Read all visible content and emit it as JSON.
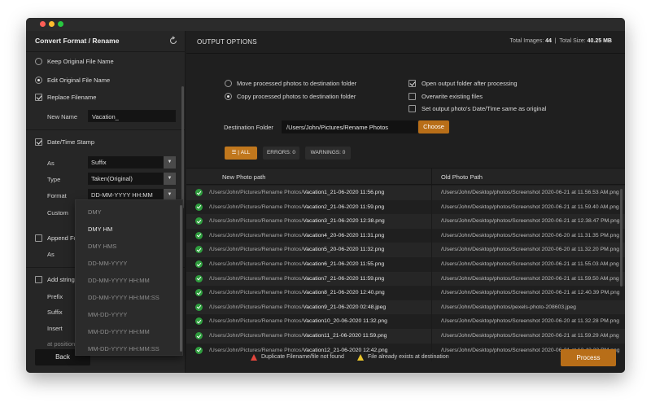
{
  "sidebar": {
    "title": "Convert Format / Rename",
    "keep_original": "Keep Original File Name",
    "edit_original": "Edit Original File Name",
    "replace_filename": "Replace Filename",
    "new_name_label": "New Name",
    "new_name_value": "Vacation_",
    "datetime_stamp": "Date/Time Stamp",
    "as_label": "As",
    "as_value": "Suffix",
    "type_label": "Type",
    "type_value": "Taken(Original)",
    "format_label": "Format",
    "format_value": "DD-MM-YYYY HH:MM",
    "custom_label": "Custom",
    "append_label": "Append Fo",
    "as2_label": "As",
    "add_string_label": "Add string",
    "prefix_label": "Prefix",
    "suffix_label": "Suffix",
    "insert_label": "Insert",
    "at_position_label": "at position",
    "back_label": "Back"
  },
  "format_dropdown": {
    "options": [
      "DMY",
      "DMY HM",
      "DMY HMS",
      "DD-MM-YYYY",
      "DD-MM-YYYY HH:MM",
      "DD-MM-YYYY HH:MM:SS",
      "MM-DD-YYYY",
      "MM-DD-YYYY HH:MM",
      "MM-DD-YYYY HH:MM:SS"
    ],
    "highlighted": "DMY HM"
  },
  "main": {
    "title": "OUTPUT OPTIONS",
    "total_images_label": "Total Images:",
    "total_images": "44",
    "total_size_label": "Total Size:",
    "total_size": "40.25 MB",
    "move_option": "Move processed photos to destination folder",
    "copy_option": "Copy processed photos to destination folder",
    "open_output": "Open output folder after processing",
    "overwrite": "Overwrite existing files",
    "set_datetime": "Set output photo's Date/Time same as original",
    "dest_label": "Destination Folder",
    "dest_value": "/Users/John/Pictures/Rename Photos",
    "choose_label": "Choose",
    "filter_all": "ALL",
    "filter_errors": "ERRORS: 0",
    "filter_warnings": "WARNINGS: 0",
    "col_new": "New Photo path",
    "col_old": "Old Photo Path",
    "legend_duplicate": "Duplicate Filename/file not found",
    "legend_exists": "File already exists at destination",
    "process_label": "Process"
  },
  "rows": [
    {
      "dir": "/Users/John/Pictures/Rename Photos/",
      "file": "Vacation1_21-06-2020 11:56.png",
      "old": "/Users/John/Desktop/photos/Screenshot 2020-06-21 at 11.56.53 AM.png"
    },
    {
      "dir": "/Users/John/Pictures/Rename Photos/",
      "file": "Vacation2_21-06-2020 11:59.png",
      "old": "/Users/John/Desktop/photos/Screenshot 2020-06-21 at 11.59.40 AM.png"
    },
    {
      "dir": "/Users/John/Pictures/Rename Photos/",
      "file": "Vacation3_21-06-2020 12:38.png",
      "old": "/Users/John/Desktop/photos/Screenshot 2020-06-21 at 12.38.47 PM.png"
    },
    {
      "dir": "/Users/John/Pictures/Rename Photos/",
      "file": "Vacation4_20-06-2020 11:31.png",
      "old": "/Users/John/Desktop/photos/Screenshot 2020-06-20 at 11.31.35 PM.png"
    },
    {
      "dir": "/Users/John/Pictures/Rename Photos/",
      "file": "Vacation5_20-06-2020 11:32.png",
      "old": "/Users/John/Desktop/photos/Screenshot 2020-06-20 at 11.32.20 PM.png"
    },
    {
      "dir": "/Users/John/Pictures/Rename Photos/",
      "file": "Vacation6_21-06-2020 11:55.png",
      "old": "/Users/John/Desktop/photos/Screenshot 2020-06-21 at 11.55.03 AM.png"
    },
    {
      "dir": "/Users/John/Pictures/Rename Photos/",
      "file": "Vacation7_21-06-2020 11:59.png",
      "old": "/Users/John/Desktop/photos/Screenshot 2020-06-21 at 11.59.50 AM.png"
    },
    {
      "dir": "/Users/John/Pictures/Rename Photos/",
      "file": "Vacation8_21-06-2020 12:40.png",
      "old": "/Users/John/Desktop/photos/Screenshot 2020-06-21 at 12.40.39 PM.png"
    },
    {
      "dir": "/Users/John/Pictures/Rename Photos/",
      "file": "Vacation9_21-06-2020 02:48.jpeg",
      "old": "/Users/John/Desktop/photos/pexels-photo-208603.jpeg"
    },
    {
      "dir": "/Users/John/Pictures/Rename Photos/",
      "file": "Vacation10_20-06-2020 11:32.png",
      "old": "/Users/John/Desktop/photos/Screenshot 2020-06-20 at 11.32.28 PM.png"
    },
    {
      "dir": "/Users/John/Pictures/Rename Photos/",
      "file": "Vacation11_21-06-2020 11:59.png",
      "old": "/Users/John/Desktop/photos/Screenshot 2020-06-21 at 11.59.29 AM.png"
    },
    {
      "dir": "/Users/John/Pictures/Rename Photos/",
      "file": "Vacation12_21-06-2020 12:42.png",
      "old": "/Users/John/Desktop/photos/Screenshot 2020-06-21 at 12.42.22 PM.png"
    }
  ],
  "colors": {
    "accent": "#b86e18",
    "success": "#2f9d3e",
    "error": "#e2453c",
    "warning": "#e8c42c"
  }
}
